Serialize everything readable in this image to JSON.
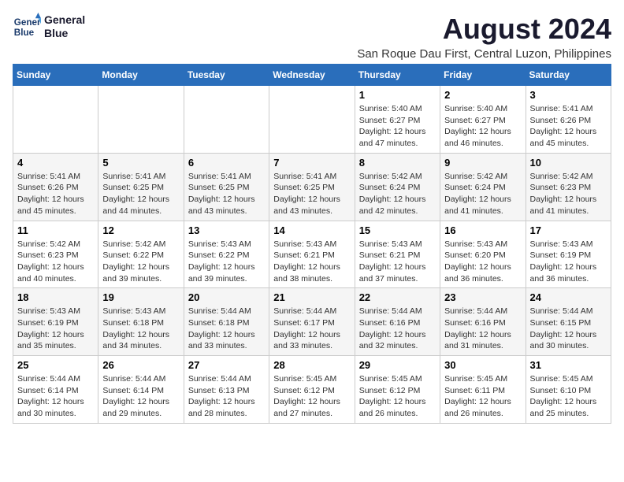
{
  "logo": {
    "line1": "General",
    "line2": "Blue"
  },
  "title": "August 2024",
  "subtitle": "San Roque Dau First, Central Luzon, Philippines",
  "days_of_week": [
    "Sunday",
    "Monday",
    "Tuesday",
    "Wednesday",
    "Thursday",
    "Friday",
    "Saturday"
  ],
  "weeks": [
    [
      {
        "day": "",
        "info": ""
      },
      {
        "day": "",
        "info": ""
      },
      {
        "day": "",
        "info": ""
      },
      {
        "day": "",
        "info": ""
      },
      {
        "day": "1",
        "info": "Sunrise: 5:40 AM\nSunset: 6:27 PM\nDaylight: 12 hours and 47 minutes."
      },
      {
        "day": "2",
        "info": "Sunrise: 5:40 AM\nSunset: 6:27 PM\nDaylight: 12 hours and 46 minutes."
      },
      {
        "day": "3",
        "info": "Sunrise: 5:41 AM\nSunset: 6:26 PM\nDaylight: 12 hours and 45 minutes."
      }
    ],
    [
      {
        "day": "4",
        "info": "Sunrise: 5:41 AM\nSunset: 6:26 PM\nDaylight: 12 hours and 45 minutes."
      },
      {
        "day": "5",
        "info": "Sunrise: 5:41 AM\nSunset: 6:25 PM\nDaylight: 12 hours and 44 minutes."
      },
      {
        "day": "6",
        "info": "Sunrise: 5:41 AM\nSunset: 6:25 PM\nDaylight: 12 hours and 43 minutes."
      },
      {
        "day": "7",
        "info": "Sunrise: 5:41 AM\nSunset: 6:25 PM\nDaylight: 12 hours and 43 minutes."
      },
      {
        "day": "8",
        "info": "Sunrise: 5:42 AM\nSunset: 6:24 PM\nDaylight: 12 hours and 42 minutes."
      },
      {
        "day": "9",
        "info": "Sunrise: 5:42 AM\nSunset: 6:24 PM\nDaylight: 12 hours and 41 minutes."
      },
      {
        "day": "10",
        "info": "Sunrise: 5:42 AM\nSunset: 6:23 PM\nDaylight: 12 hours and 41 minutes."
      }
    ],
    [
      {
        "day": "11",
        "info": "Sunrise: 5:42 AM\nSunset: 6:23 PM\nDaylight: 12 hours and 40 minutes."
      },
      {
        "day": "12",
        "info": "Sunrise: 5:42 AM\nSunset: 6:22 PM\nDaylight: 12 hours and 39 minutes."
      },
      {
        "day": "13",
        "info": "Sunrise: 5:43 AM\nSunset: 6:22 PM\nDaylight: 12 hours and 39 minutes."
      },
      {
        "day": "14",
        "info": "Sunrise: 5:43 AM\nSunset: 6:21 PM\nDaylight: 12 hours and 38 minutes."
      },
      {
        "day": "15",
        "info": "Sunrise: 5:43 AM\nSunset: 6:21 PM\nDaylight: 12 hours and 37 minutes."
      },
      {
        "day": "16",
        "info": "Sunrise: 5:43 AM\nSunset: 6:20 PM\nDaylight: 12 hours and 36 minutes."
      },
      {
        "day": "17",
        "info": "Sunrise: 5:43 AM\nSunset: 6:19 PM\nDaylight: 12 hours and 36 minutes."
      }
    ],
    [
      {
        "day": "18",
        "info": "Sunrise: 5:43 AM\nSunset: 6:19 PM\nDaylight: 12 hours and 35 minutes."
      },
      {
        "day": "19",
        "info": "Sunrise: 5:43 AM\nSunset: 6:18 PM\nDaylight: 12 hours and 34 minutes."
      },
      {
        "day": "20",
        "info": "Sunrise: 5:44 AM\nSunset: 6:18 PM\nDaylight: 12 hours and 33 minutes."
      },
      {
        "day": "21",
        "info": "Sunrise: 5:44 AM\nSunset: 6:17 PM\nDaylight: 12 hours and 33 minutes."
      },
      {
        "day": "22",
        "info": "Sunrise: 5:44 AM\nSunset: 6:16 PM\nDaylight: 12 hours and 32 minutes."
      },
      {
        "day": "23",
        "info": "Sunrise: 5:44 AM\nSunset: 6:16 PM\nDaylight: 12 hours and 31 minutes."
      },
      {
        "day": "24",
        "info": "Sunrise: 5:44 AM\nSunset: 6:15 PM\nDaylight: 12 hours and 30 minutes."
      }
    ],
    [
      {
        "day": "25",
        "info": "Sunrise: 5:44 AM\nSunset: 6:14 PM\nDaylight: 12 hours and 30 minutes."
      },
      {
        "day": "26",
        "info": "Sunrise: 5:44 AM\nSunset: 6:14 PM\nDaylight: 12 hours and 29 minutes."
      },
      {
        "day": "27",
        "info": "Sunrise: 5:44 AM\nSunset: 6:13 PM\nDaylight: 12 hours and 28 minutes."
      },
      {
        "day": "28",
        "info": "Sunrise: 5:45 AM\nSunset: 6:12 PM\nDaylight: 12 hours and 27 minutes."
      },
      {
        "day": "29",
        "info": "Sunrise: 5:45 AM\nSunset: 6:12 PM\nDaylight: 12 hours and 26 minutes."
      },
      {
        "day": "30",
        "info": "Sunrise: 5:45 AM\nSunset: 6:11 PM\nDaylight: 12 hours and 26 minutes."
      },
      {
        "day": "31",
        "info": "Sunrise: 5:45 AM\nSunset: 6:10 PM\nDaylight: 12 hours and 25 minutes."
      }
    ]
  ]
}
